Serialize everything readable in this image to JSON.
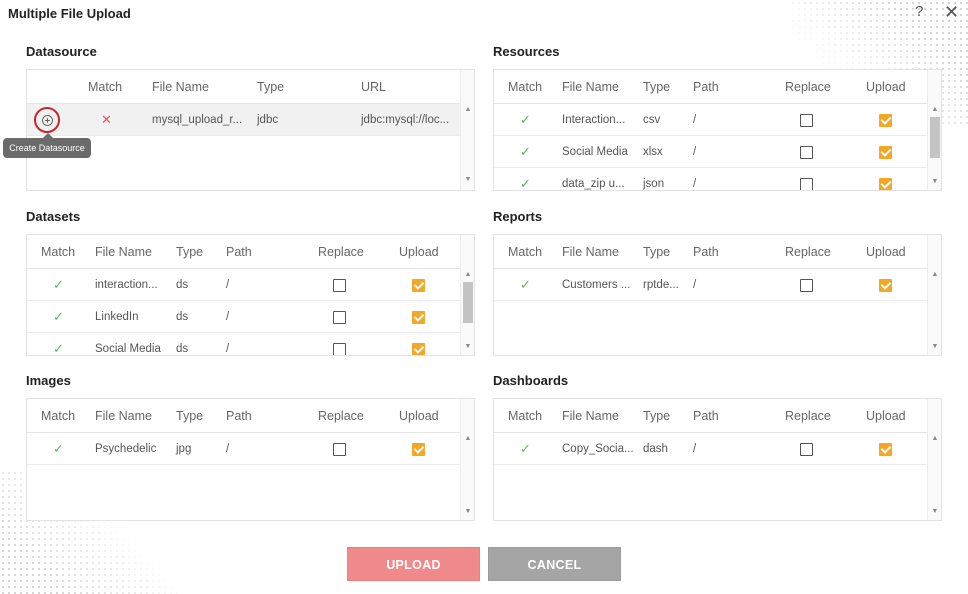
{
  "dialog": {
    "title": "Multiple File Upload"
  },
  "sections": {
    "datasource": {
      "title": "Datasource",
      "headers": {
        "match": "Match",
        "file": "File Name",
        "type": "Type",
        "url": "URL"
      },
      "rows": [
        {
          "match": "✕",
          "file": "mysql_upload_r...",
          "type": "jdbc",
          "url": "jdbc:mysql://loc..."
        }
      ],
      "tooltip": "Create Datasource"
    },
    "resources": {
      "title": "Resources",
      "headers": {
        "match": "Match",
        "file": "File Name",
        "type": "Type",
        "path": "Path",
        "replace": "Replace",
        "upload": "Upload"
      },
      "rows": [
        {
          "match": "✓",
          "file": "Interaction...",
          "type": "csv",
          "path": "/"
        },
        {
          "match": "✓",
          "file": "Social Media",
          "type": "xlsx",
          "path": "/"
        },
        {
          "match": "✓",
          "file": "data_zip u...",
          "type": "json",
          "path": "/"
        }
      ]
    },
    "datasets": {
      "title": "Datasets",
      "headers": {
        "match": "Match",
        "file": "File Name",
        "type": "Type",
        "path": "Path",
        "replace": "Replace",
        "upload": "Upload"
      },
      "rows": [
        {
          "match": "✓",
          "file": "interaction...",
          "type": "ds",
          "path": "/"
        },
        {
          "match": "✓",
          "file": "LinkedIn",
          "type": "ds",
          "path": "/"
        },
        {
          "match": "✓",
          "file": "Social Media",
          "type": "ds",
          "path": "/"
        }
      ]
    },
    "reports": {
      "title": "Reports",
      "headers": {
        "match": "Match",
        "file": "File Name",
        "type": "Type",
        "path": "Path",
        "replace": "Replace",
        "upload": "Upload"
      },
      "rows": [
        {
          "match": "✓",
          "file": "Customers ...",
          "type": "rptde...",
          "path": "/"
        }
      ]
    },
    "images": {
      "title": "Images",
      "headers": {
        "match": "Match",
        "file": "File Name",
        "type": "Type",
        "path": "Path",
        "replace": "Replace",
        "upload": "Upload"
      },
      "rows": [
        {
          "match": "✓",
          "file": "Psychedelic",
          "type": "jpg",
          "path": "/"
        }
      ]
    },
    "dashboards": {
      "title": "Dashboards",
      "headers": {
        "match": "Match",
        "file": "File Name",
        "type": "Type",
        "path": "Path",
        "replace": "Replace",
        "upload": "Upload"
      },
      "rows": [
        {
          "match": "✓",
          "file": "Copy_Socia...",
          "type": "dash",
          "path": "/"
        }
      ]
    }
  },
  "buttons": {
    "upload": "UPLOAD",
    "cancel": "CANCEL"
  },
  "colors": {
    "accent_checkbox": "#f5a623",
    "upload_button": "#f08a8a",
    "cancel_button": "#a5a5a5",
    "match_ok": "#5cb85c",
    "match_fail": "#e05a5a",
    "highlight_ring": "#c62828"
  },
  "icons": {
    "help": "?",
    "close": "✕"
  }
}
